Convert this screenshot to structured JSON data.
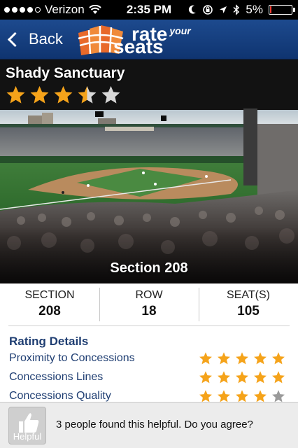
{
  "status_bar": {
    "carrier": "Verizon",
    "time": "2:35 PM",
    "battery": "5%",
    "battery_level": 0.05
  },
  "nav": {
    "back_label": "Back",
    "logo": {
      "rate": "rate",
      "your": "your",
      "seats": "seats"
    }
  },
  "review": {
    "title": "Shady Sanctuary",
    "stars": 3.5,
    "section_caption": "Section 208"
  },
  "seat_info": {
    "section": {
      "label": "SECTION",
      "value": "208"
    },
    "row": {
      "label": "ROW",
      "value": "18"
    },
    "seats": {
      "label": "SEAT(S)",
      "value": "105"
    }
  },
  "rating_details": {
    "heading": "Rating Details",
    "items": [
      {
        "label": "Proximity to Concessions",
        "stars": 5
      },
      {
        "label": "Concessions Lines",
        "stars": 5
      },
      {
        "label": "Concessions Quality",
        "stars": 4
      }
    ]
  },
  "helpful": {
    "button_label": "Helpful",
    "text": "3 people found this helpful. Do you agree?"
  },
  "colors": {
    "nav": "#1d4a8e",
    "star": "#f5a31a",
    "star_empty": "#9a9a9a",
    "heading": "#1f3e72"
  }
}
